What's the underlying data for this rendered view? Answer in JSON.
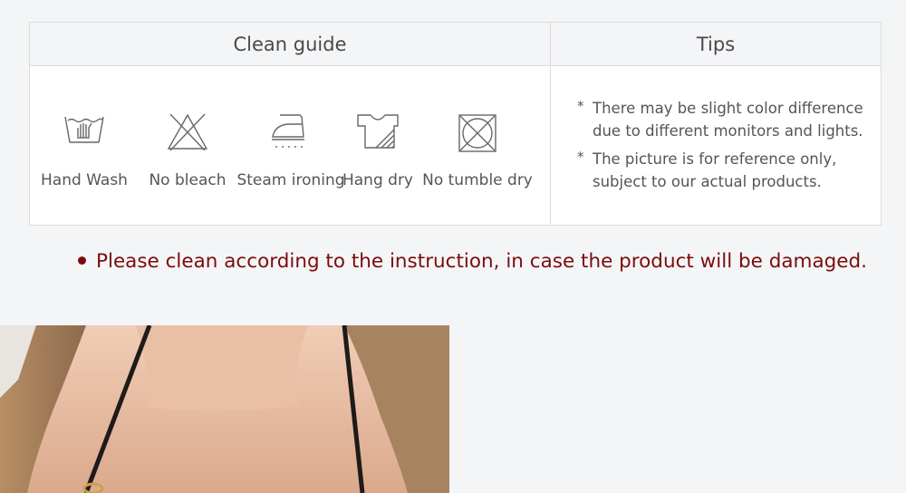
{
  "table": {
    "headers": {
      "guide": "Clean guide",
      "tips": "Tips"
    },
    "care_items": [
      {
        "icon": "hand-wash-icon",
        "label": "Hand Wash"
      },
      {
        "icon": "no-bleach-icon",
        "label": "No bleach"
      },
      {
        "icon": "steam-iron-icon",
        "label": "Steam ironing"
      },
      {
        "icon": "hang-dry-icon",
        "label": "Hang dry"
      },
      {
        "icon": "no-tumble-dry-icon",
        "label": "No tumble dry"
      }
    ],
    "tips": [
      {
        "marker": "*",
        "text": "There may be slight color difference due to different monitors and lights."
      },
      {
        "marker": "*",
        "text": "The picture is for reference only, subject to our actual products."
      }
    ]
  },
  "notice": {
    "text": "Please clean according to the instruction, in case the product will be damaged.",
    "color": "#7b0c0c"
  },
  "colors": {
    "background": "#f4f5f7",
    "border": "#dcdcdc",
    "icon": "#666666"
  }
}
